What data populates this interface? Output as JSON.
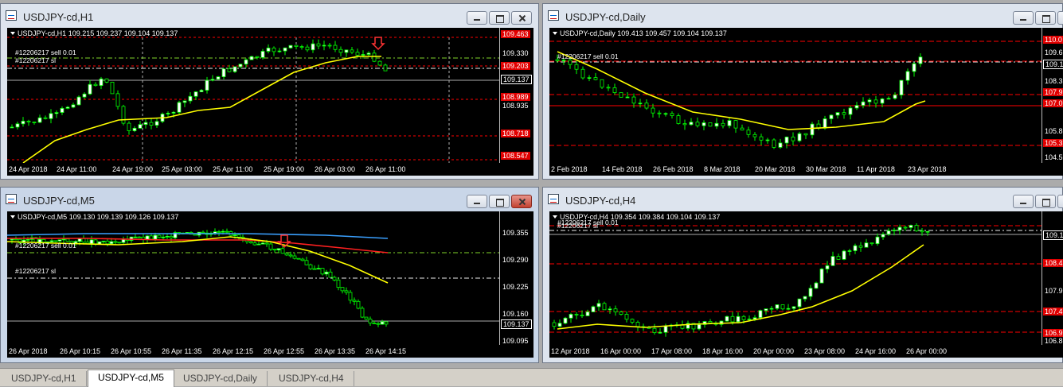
{
  "windows": [
    {
      "title": "USDJPY-cd,H1",
      "info": "USDJPY-cd,H1  109.215 109.237 109.104 109.137",
      "orders": [
        {
          "text": "#12206217 sell 0.01"
        },
        {
          "text": "#12206217 sl"
        }
      ],
      "prices": [
        {
          "v": "109.463",
          "kind": "red"
        },
        {
          "v": "109.330",
          "kind": "plain"
        },
        {
          "v": "109.203",
          "kind": "red"
        },
        {
          "v": "109.137",
          "kind": "box"
        },
        {
          "v": "108.989",
          "kind": "red"
        },
        {
          "v": "108.935",
          "kind": "plain"
        },
        {
          "v": "108.718",
          "kind": "red"
        },
        {
          "v": "108.547",
          "kind": "red"
        }
      ],
      "times": [
        "24 Apr 2018",
        "24 Apr 11:00",
        "24 Apr 19:00",
        "25 Apr 03:00",
        "25 Apr 11:00",
        "25 Apr 19:00",
        "26 Apr 03:00",
        "26 Apr 11:00"
      ]
    },
    {
      "title": "USDJPY-cd,Daily",
      "info": "USDJPY-cd,Daily  109.413 109.457 109.104 109.137",
      "orders": [
        {
          "text": "#12206217 sell 0.01"
        }
      ],
      "prices": [
        {
          "v": "110.0",
          "kind": "red"
        },
        {
          "v": "109.6",
          "kind": "plain"
        },
        {
          "v": "109.1",
          "kind": "box"
        },
        {
          "v": "108.3",
          "kind": "plain"
        },
        {
          "v": "107.9",
          "kind": "red"
        },
        {
          "v": "107.0",
          "kind": "red"
        },
        {
          "v": "105.8",
          "kind": "plain"
        },
        {
          "v": "105.3",
          "kind": "red"
        },
        {
          "v": "104.5",
          "kind": "plain"
        }
      ],
      "times": [
        "2 Feb 2018",
        "14 Feb 2018",
        "26 Feb 2018",
        "8 Mar 2018",
        "20 Mar 2018",
        "30 Mar 2018",
        "11 Apr 2018",
        "23 Apr 2018"
      ]
    },
    {
      "title": "USDJPY-cd,M5",
      "info": "USDJPY-cd,M5  109.130 109.139 109.126 109.137",
      "orders": [
        {
          "text": "#12206217 sell 0.01"
        },
        {
          "text": "#12206217 sl"
        }
      ],
      "prices": [
        {
          "v": "109.355",
          "kind": "plain"
        },
        {
          "v": "109.290",
          "kind": "plain"
        },
        {
          "v": "109.225",
          "kind": "plain"
        },
        {
          "v": "109.160",
          "kind": "plain"
        },
        {
          "v": "109.137",
          "kind": "box"
        },
        {
          "v": "109.095",
          "kind": "plain"
        }
      ],
      "times": [
        "26 Apr 2018",
        "26 Apr 10:15",
        "26 Apr 10:55",
        "26 Apr 11:35",
        "26 Apr 12:15",
        "26 Apr 12:55",
        "26 Apr 13:35",
        "26 Apr 14:15"
      ]
    },
    {
      "title": "USDJPY-cd,H4",
      "info": "USDJPY-cd,H4  109.354 109.384 109.104 109.137",
      "orders": [
        {
          "text": "#12206217 sell 0.01"
        },
        {
          "text": "#12206217 sl"
        }
      ],
      "prices": [
        {
          "v": "109.1",
          "kind": "box"
        },
        {
          "v": "108.4",
          "kind": "red"
        },
        {
          "v": "107.9",
          "kind": "plain"
        },
        {
          "v": "107.4",
          "kind": "red"
        },
        {
          "v": "106.9",
          "kind": "red"
        },
        {
          "v": "106.8",
          "kind": "plain"
        }
      ],
      "times": [
        "12 Apr 2018",
        "16 Apr 00:00",
        "17 Apr 08:00",
        "18 Apr 16:00",
        "20 Apr 00:00",
        "23 Apr 08:00",
        "24 Apr 16:00",
        "26 Apr 00:00"
      ]
    }
  ],
  "tabs": [
    "USDJPY-cd,H1",
    "USDJPY-cd,M5",
    "USDJPY-cd,Daily",
    "USDJPY-cd,H4"
  ],
  "colors": {
    "bull": "#ffffff",
    "bear": "#000000",
    "wick": "#00ff00",
    "ma": "#ffff00",
    "blue_ma": "#3aa0ff",
    "red_ma": "#ff2020",
    "sl": "#ff0000",
    "order": "#7fd42a",
    "grid": "#ffffff"
  }
}
